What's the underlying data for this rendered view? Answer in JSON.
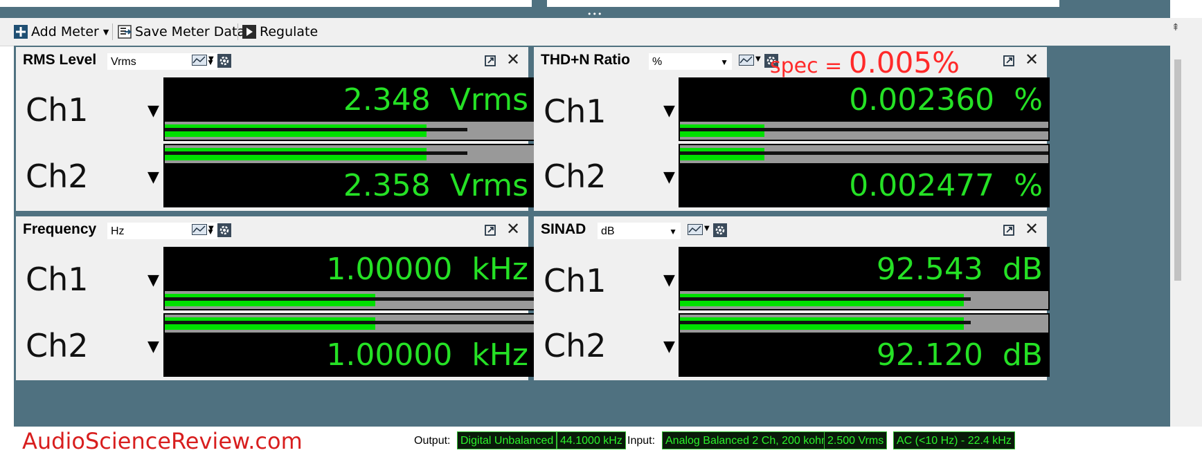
{
  "toolbar": {
    "add_meter": "Add Meter",
    "save_meter_data": "Save Meter Data",
    "regulate": "Regulate"
  },
  "panels": {
    "rms": {
      "title": "RMS Level",
      "unit": "Vrms",
      "ch1": {
        "label": "Ch1",
        "value": "2.348",
        "unit": "Vrms",
        "level": 0.71,
        "peak": 0.82
      },
      "ch2": {
        "label": "Ch2",
        "value": "2.358",
        "unit": "Vrms",
        "level": 0.71,
        "peak": 0.82
      }
    },
    "thdn": {
      "title": "THD+N Ratio",
      "unit": "%",
      "ch1": {
        "label": "Ch1",
        "value": "0.002360",
        "unit": "%",
        "level": 0.23,
        "peak": 1.0
      },
      "ch2": {
        "label": "Ch2",
        "value": "0.002477",
        "unit": "%",
        "level": 0.23,
        "peak": 1.0
      }
    },
    "freq": {
      "title": "Frequency",
      "unit": "Hz",
      "ch1": {
        "label": "Ch1",
        "value": "1.00000",
        "unit": "kHz",
        "level": 0.57,
        "peak": 1.0
      },
      "ch2": {
        "label": "Ch2",
        "value": "1.00000",
        "unit": "kHz",
        "level": 0.57,
        "peak": 1.0
      }
    },
    "sinad": {
      "title": "SINAD",
      "unit": "dB",
      "ch1": {
        "label": "Ch1",
        "value": "92.543",
        "unit": "dB",
        "level": 0.77,
        "peak": 0.79
      },
      "ch2": {
        "label": "Ch2",
        "value": "92.120",
        "unit": "dB",
        "level": 0.77,
        "peak": 0.79
      }
    }
  },
  "annotation": {
    "prefix": "spec = ",
    "value": "0.005%",
    "color": "#ff2a2a"
  },
  "status": {
    "brand": "AudioScienceReview.com",
    "output_label": "Output:",
    "output_value": "Digital Unbalanced",
    "output_rate": "44.1000 kHz",
    "input_label": "Input:",
    "input_value": "Analog Balanced 2 Ch, 200 kohm",
    "input_range": "2.500 Vrms",
    "input_coupling": "AC (<10 Hz) - 22.4 kHz"
  },
  "colors": {
    "readout": "#25e125",
    "bar_fill": "#00e000",
    "frame": "#4f7180"
  }
}
